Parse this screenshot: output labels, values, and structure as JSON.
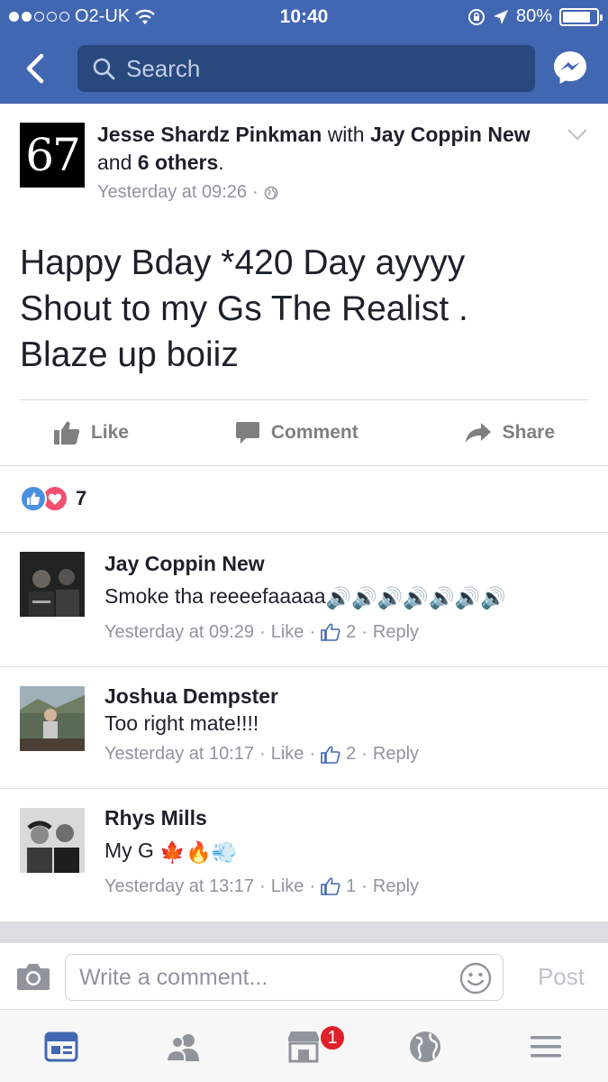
{
  "status_bar": {
    "carrier": "O2-UK",
    "time": "10:40",
    "battery": "80%"
  },
  "header": {
    "search_placeholder": "Search"
  },
  "post": {
    "avatar_text": "67",
    "author": "Jesse Shardz Pinkman",
    "with_word": "with",
    "tagged": "Jay Coppin New",
    "and_word": "and",
    "others": "6 others",
    "timestamp": "Yesterday at 09:26",
    "privacy_icon": "globe-icon",
    "text": "Happy Bday *420 Day ayyyy\nShout to my Gs The Realist .\nBlaze up boiiz",
    "actions": {
      "like": "Like",
      "comment": "Comment",
      "share": "Share"
    },
    "reaction_count": "7"
  },
  "comments": [
    {
      "name": "Jay Coppin New",
      "text": "Smoke tha reeeefaaaaa",
      "emoji": "🔊🔊🔊🔊🔊🔊🔊",
      "timestamp": "Yesterday at 09:29",
      "like_label": "Like",
      "likes": "2",
      "reply_label": "Reply"
    },
    {
      "name": "Joshua Dempster",
      "text": "Too right mate!!!!",
      "emoji": "",
      "timestamp": "Yesterday at 10:17",
      "like_label": "Like",
      "likes": "2",
      "reply_label": "Reply"
    },
    {
      "name": "Rhys Mills",
      "text": "My G",
      "emoji": "🍁🔥💨",
      "timestamp": "Yesterday at 13:17",
      "like_label": "Like",
      "likes": "1",
      "reply_label": "Reply"
    }
  ],
  "composer": {
    "placeholder": "Write a comment...",
    "post_label": "Post"
  },
  "tabbar": {
    "marketplace_badge": "1"
  },
  "colors": {
    "brand_blue": "#4267b2",
    "search_bg": "#29487d",
    "meta_gray": "#90949c",
    "badge_red": "#e0212b"
  }
}
